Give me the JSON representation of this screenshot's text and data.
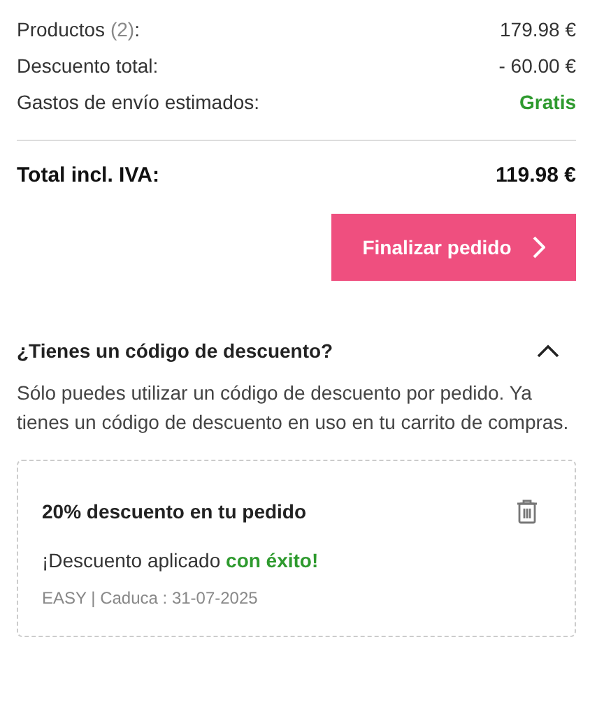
{
  "summary": {
    "rows": [
      {
        "label": "Productos",
        "count": "(2)",
        "suffix": ":",
        "value": "179.98 €",
        "kind": "plain"
      },
      {
        "label": "Descuento total:",
        "value": "- 60.00 €",
        "kind": "plain"
      },
      {
        "label": "Gastos de envío estimados:",
        "value": "Gratis",
        "kind": "free"
      }
    ],
    "total": {
      "label": "Total incl. IVA:",
      "value": "119.98 €"
    }
  },
  "checkout_button": {
    "label": "Finalizar pedido"
  },
  "discount": {
    "title": "¿Tienes un código de descuento?",
    "expanded": true,
    "note": "Sólo puedes utilizar un código de descuento por pedido. Ya tienes un código de descuento en uso en tu carrito de compras.",
    "coupon": {
      "title": "20% descuento en tu pedido",
      "status": "¡Descuento aplicado **con éxito!**",
      "details": "EASY | Caduca : 31-07-2025"
    }
  }
}
